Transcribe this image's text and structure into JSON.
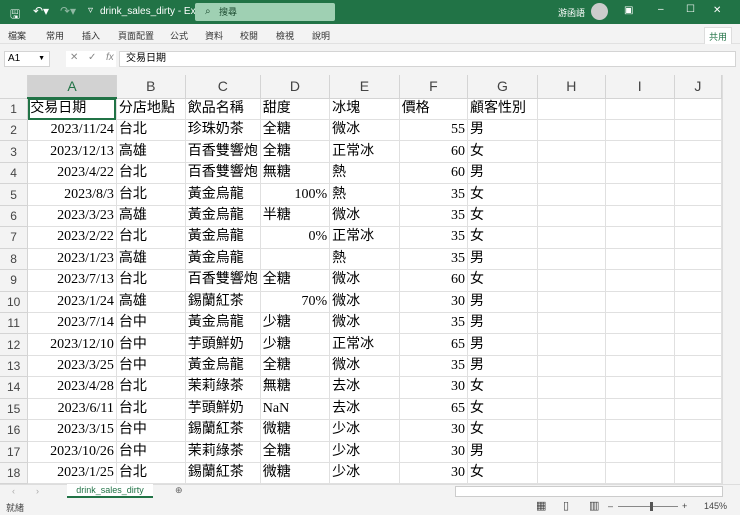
{
  "title": "drink_sales_dirty  -  Excel",
  "search_placeholder": "搜尋",
  "user": "游函語",
  "ribbon_tabs": [
    "檔案",
    "常用",
    "插入",
    "頁面配置",
    "公式",
    "資料",
    "校閱",
    "檢視",
    "說明"
  ],
  "share": "共用",
  "name_box": "A1",
  "formula": "交易日期",
  "columns": [
    "A",
    "B",
    "C",
    "D",
    "E",
    "F",
    "G",
    "H",
    "I",
    "J"
  ],
  "rows": [
    [
      "交易日期",
      "分店地點",
      "飲品名稱",
      "甜度",
      "冰塊",
      "價格",
      "顧客性別"
    ],
    [
      "2023/11/24",
      "台北",
      "珍珠奶茶",
      "全糖",
      "微冰",
      "55",
      "男"
    ],
    [
      "2023/12/13",
      "高雄",
      "百香雙響炮",
      "全糖",
      "正常冰",
      "60",
      "女"
    ],
    [
      "2023/4/22",
      "台北",
      "百香雙響炮",
      "無糖",
      "熱",
      "60",
      "男"
    ],
    [
      "2023/8/3",
      "台北",
      "黃金烏龍",
      "100%",
      "熱",
      "35",
      "女"
    ],
    [
      "2023/3/23",
      "高雄",
      "黃金烏龍",
      "半糖",
      "微冰",
      "35",
      "女"
    ],
    [
      "2023/2/22",
      "台北",
      "黃金烏龍",
      "0%",
      "正常冰",
      "35",
      "女"
    ],
    [
      "2023/1/23",
      "高雄",
      "黃金烏龍",
      "",
      "熱",
      "35",
      "男"
    ],
    [
      "2023/7/13",
      "台北",
      "百香雙響炮",
      "全糖",
      "微冰",
      "60",
      "女"
    ],
    [
      "2023/1/24",
      "高雄",
      "錫蘭紅茶",
      "70%",
      "微冰",
      "30",
      "男"
    ],
    [
      "2023/7/14",
      "台中",
      "黃金烏龍",
      "少糖",
      "微冰",
      "35",
      "男"
    ],
    [
      "2023/12/10",
      "台中",
      "芋頭鮮奶",
      "少糖",
      "正常冰",
      "65",
      "男"
    ],
    [
      "2023/3/25",
      "台中",
      "黃金烏龍",
      "全糖",
      "微冰",
      "35",
      "男"
    ],
    [
      "2023/4/28",
      "台北",
      "茉莉綠茶",
      "無糖",
      "去冰",
      "30",
      "女"
    ],
    [
      "2023/6/11",
      "台北",
      "芋頭鮮奶",
      "NaN",
      "去冰",
      "65",
      "女"
    ],
    [
      "2023/3/15",
      "台中",
      "錫蘭紅茶",
      "微糖",
      "少冰",
      "30",
      "女"
    ],
    [
      "2023/10/26",
      "台中",
      "茉莉綠茶",
      "全糖",
      "少冰",
      "30",
      "男"
    ],
    [
      "2023/1/25",
      "台北",
      "錫蘭紅茶",
      "微糖",
      "少冰",
      "30",
      "女"
    ]
  ],
  "sheet_tab": "drink_sales_dirty",
  "status": "就緒",
  "zoom": "145%",
  "accent": "#217346"
}
